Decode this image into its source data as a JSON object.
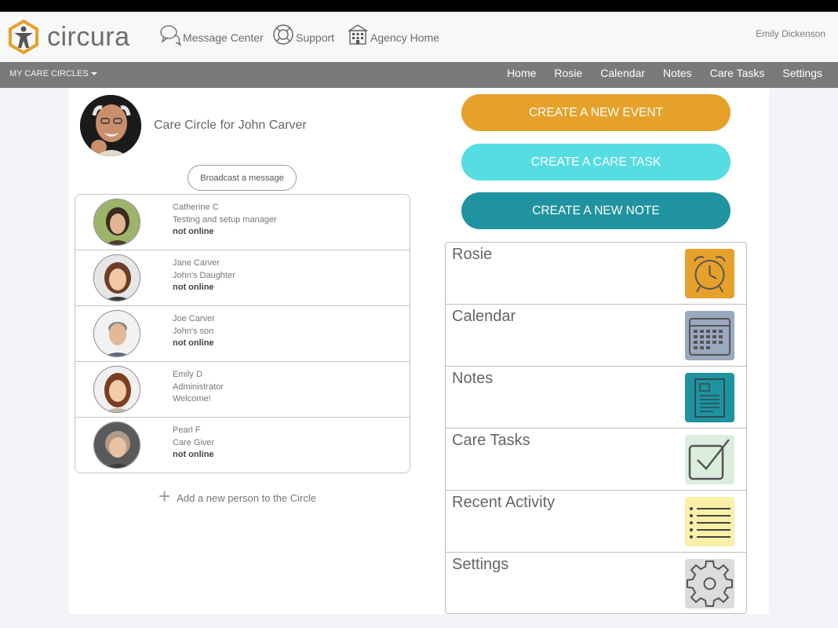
{
  "app": {
    "logo_text": "circura",
    "brand_color": "#e5a12a"
  },
  "header": {
    "nav": [
      {
        "label": "Message Center",
        "icon": "chat-bubbles-icon"
      },
      {
        "label": "Support",
        "icon": "lifebuoy-icon"
      },
      {
        "label": "Agency Home",
        "icon": "building-icon"
      }
    ],
    "user_name": "Emily Dickenson"
  },
  "navbar": {
    "dropdown_label": "MY CARE CIRCLES",
    "links": [
      "Home",
      "Rosie",
      "Calendar",
      "Notes",
      "Care Tasks",
      "Settings"
    ]
  },
  "circle": {
    "title": "Care Circle for John Carver",
    "broadcast_label": "Broadcast a message",
    "members": [
      {
        "name": "Catherine C",
        "role": "Testing and setup manager",
        "status": "not online"
      },
      {
        "name": "Jane Carver",
        "role": "John's Daughter",
        "status": "not online"
      },
      {
        "name": "Joe Carver",
        "role": "John's son",
        "status": "not online"
      },
      {
        "name": "Emily D",
        "role": "Administrator",
        "status": "Welcome!"
      },
      {
        "name": "Pearl F",
        "role": "Care Giver",
        "status": "not online"
      }
    ],
    "add_person_label": "Add a new person to the Circle"
  },
  "actions": {
    "create_event": "CREATE A NEW EVENT",
    "create_task": "CREATE A CARE TASK",
    "create_note": "CREATE A NEW NOTE"
  },
  "tiles": [
    {
      "label": "Rosie",
      "icon": "alarm-clock-icon",
      "color": "#e5a12a"
    },
    {
      "label": "Calendar",
      "icon": "calendar-icon",
      "color": "#9aa8c0"
    },
    {
      "label": "Notes",
      "icon": "notepad-icon",
      "color": "#1f939f"
    },
    {
      "label": "Care Tasks",
      "icon": "checkbox-icon",
      "color": "#dbeedd"
    },
    {
      "label": "Recent Activity",
      "icon": "list-icon",
      "color": "#fbf0a8"
    },
    {
      "label": "Settings",
      "icon": "gear-icon",
      "color": "#dcdcdc"
    }
  ]
}
